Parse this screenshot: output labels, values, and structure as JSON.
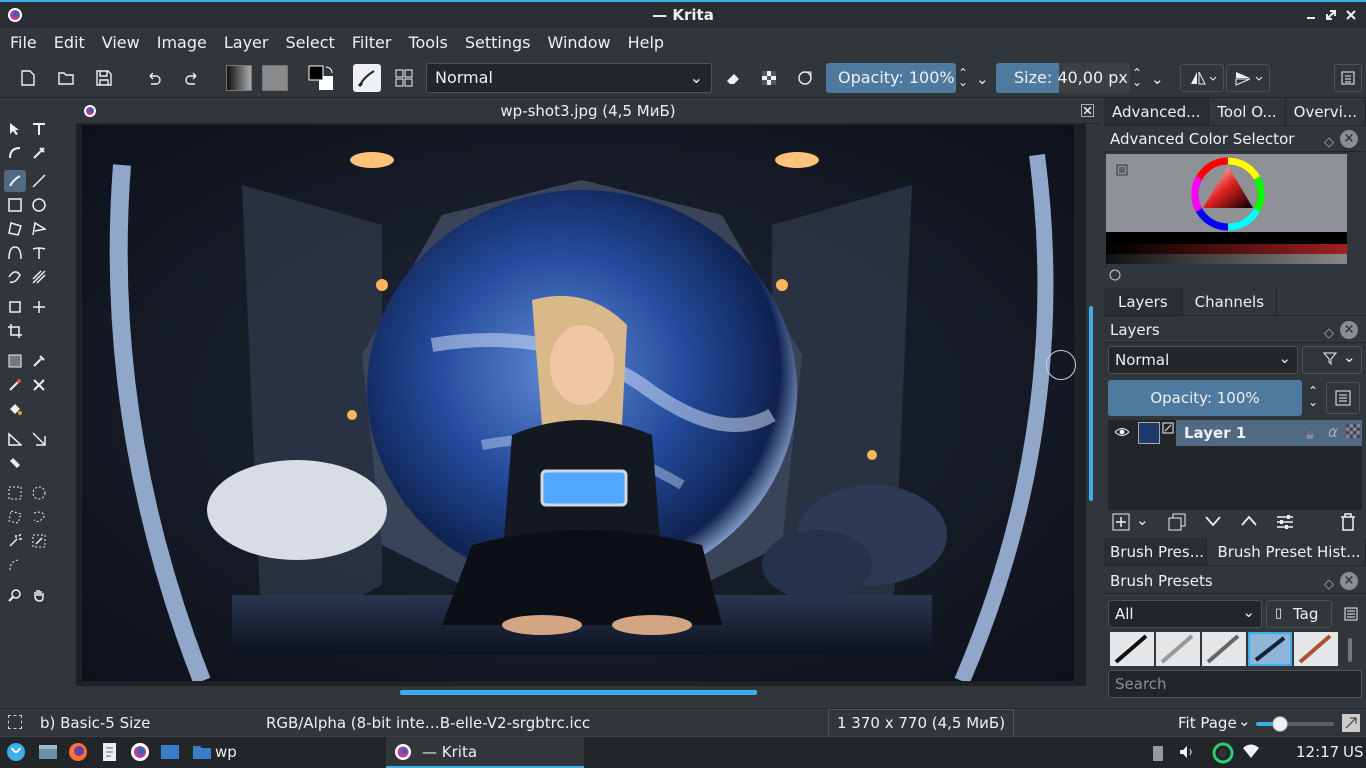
{
  "window": {
    "title": "— Krita"
  },
  "menu": [
    "File",
    "Edit",
    "View",
    "Image",
    "Layer",
    "Select",
    "Filter",
    "Tools",
    "Settings",
    "Window",
    "Help"
  ],
  "toolbar": {
    "blend_mode": "Normal",
    "opacity_label": "Opacity: 100%",
    "opacity_value": 1.0,
    "size_label": "Size: 40,00 px",
    "size_fill": 0.47
  },
  "document": {
    "tab_title": "wp-shot3.jpg (4,5 МиБ)"
  },
  "dock": {
    "top_tabs": [
      "Advanced...",
      "Tool O...",
      "Overvi..."
    ],
    "color_selector_title": "Advanced Color Selector",
    "layer_tabs": [
      "Layers",
      "Channels"
    ],
    "layers_title": "Layers",
    "layer_blend": "Normal",
    "layer_opacity": "Opacity:  100%",
    "layers": [
      {
        "name": "Layer 1"
      }
    ],
    "brush_tabs": [
      "Brush Pres...",
      "Brush Preset Hist..."
    ],
    "brush_title": "Brush Presets",
    "brush_filter": "All",
    "tag_label": "Tag",
    "search_placeholder": "Search"
  },
  "status": {
    "brush": "b) Basic-5 Size",
    "color_profile": "RGB/Alpha (8-bit inte…B-elle-V2-srgbtrc.icc",
    "dimensions": "1 370 x 770 (4,5 МиБ)",
    "zoom": "Fit Page"
  },
  "taskbar": {
    "folder": "wp",
    "active_app": "— Krita",
    "clock": "12:17",
    "keyboard": "US"
  },
  "colors": {
    "accent": "#3daee9",
    "window_bg": "#31363b",
    "selection": "#4f7aa0"
  }
}
